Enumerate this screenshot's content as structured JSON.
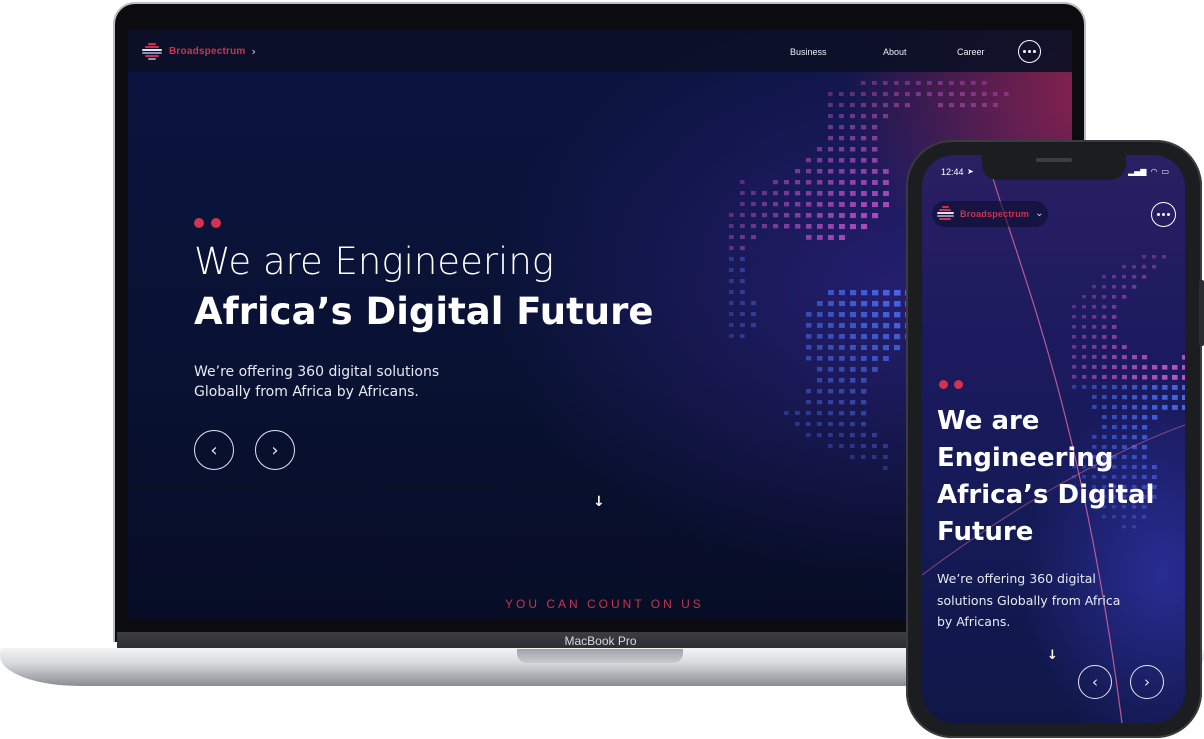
{
  "laptop": {
    "nav": {
      "brand": "Broadspectrum",
      "brand_chevron": "›",
      "links": [
        "Business",
        "About",
        "Career"
      ],
      "more_icon": "more-horizontal-icon"
    },
    "hero": {
      "line1": "We are Engineering",
      "line2": "Africa’s Digital Future",
      "sub_line1": "We’re offering 360 digital solutions",
      "sub_line2": "Globally from Africa by Africans.",
      "prev_glyph": "‹",
      "next_glyph": "›",
      "scroll_glyph": "↓"
    },
    "tagline": "YOU CAN COUNT ON US",
    "device_label": "MacBook Pro"
  },
  "phone": {
    "status": {
      "time": "12:44",
      "location_glyph": "➤",
      "signal_glyph": "▂▄▆",
      "wifi_glyph": "◠",
      "battery_glyph": "▭"
    },
    "nav": {
      "brand": "Broadspectrum",
      "brand_chevron": "⌄",
      "more_icon": "more-horizontal-icon"
    },
    "hero": {
      "lines": [
        "We are",
        "Engineering",
        "Africa’s Digital",
        "Future"
      ],
      "sub_lines": [
        "We’re offering 360 digital",
        "solutions Globally from Africa",
        "by Africans."
      ],
      "prev_glyph": "‹",
      "next_glyph": "›",
      "scroll_glyph": "↓"
    }
  },
  "colors": {
    "brand_red": "#c8344f",
    "accent_dot": "#d2344f",
    "bg_navy": "#091233",
    "globe_blue": "#4a6cf0",
    "globe_pink": "#d35ad8"
  }
}
